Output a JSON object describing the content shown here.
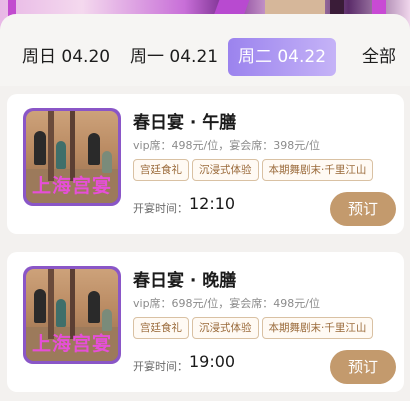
{
  "tabs": [
    {
      "label": "周日 04.20",
      "active": false
    },
    {
      "label": "周一 04.21",
      "active": false
    },
    {
      "label": "周二 04.22",
      "active": true
    },
    {
      "label": "全部",
      "active": false
    }
  ],
  "colors": {
    "active_tab_start": "#9b83ee",
    "active_tab_end": "#c5b3f7",
    "book_button": "#c39a6d",
    "tag_text": "#9a6a3a",
    "logo_text": "#e64fd8"
  },
  "events": [
    {
      "title": "春日宴 · 午膳",
      "thumb_text": "上海宫宴",
      "price": "vip席：498元/位，宴会席：398元/位",
      "tags": [
        "宫廷食礼",
        "沉浸式体验",
        "本期舞剧末·千里江山"
      ],
      "time_label": "开宴时间：",
      "time": "12:10",
      "book_label": "预订"
    },
    {
      "title": "春日宴 · 晚膳",
      "thumb_text": "上海宫宴",
      "price": "vip席：698元/位，宴会席：498元/位",
      "tags": [
        "宫廷食礼",
        "沉浸式体验",
        "本期舞剧末·千里江山"
      ],
      "time_label": "开宴时间：",
      "time": "19:00",
      "book_label": "预订"
    }
  ]
}
